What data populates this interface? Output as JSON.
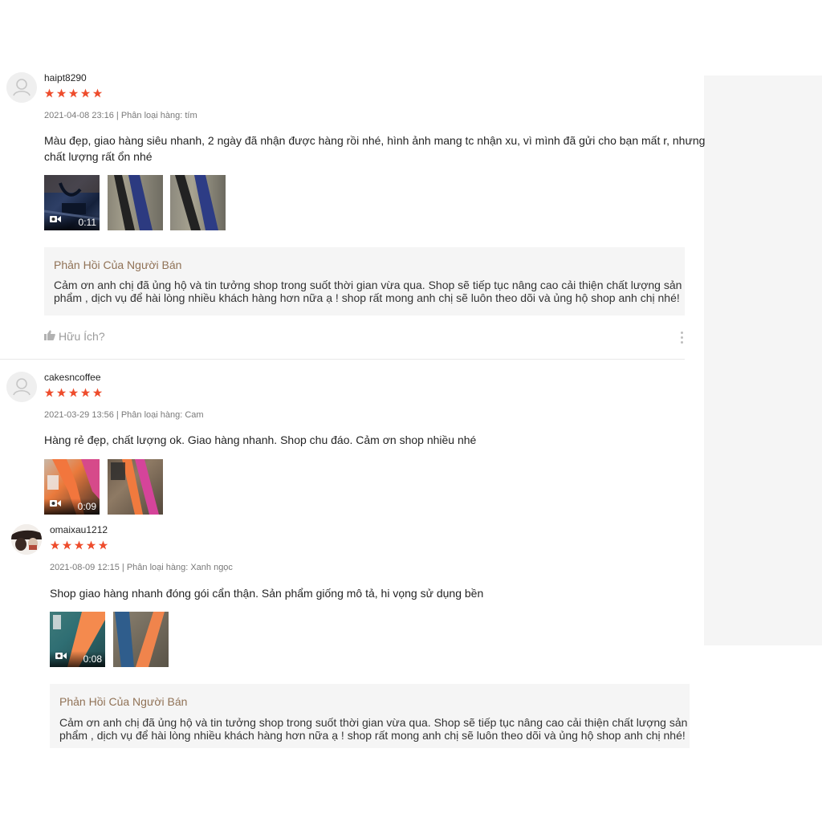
{
  "reviews": [
    {
      "username": "haipt8290",
      "rating": 5,
      "meta": "2021-04-08 23:16 | Phân loại hàng: tím",
      "content_line1": "Màu đẹp, giao hàng siêu nhanh, 2 ngày đã nhận được hàng rồi nhé, hình ảnh mang tc nhận xu, vì mình đã gửi cho bạn mất r, nhưng",
      "content_line2": "chất lượng rất ổn nhé",
      "video_duration": "0:11",
      "reply_title": "Phản Hồi Của Người Bán",
      "reply_line1": "Cảm ơn anh chị đã ủng hộ và tin tưởng shop trong suốt thời gian vừa qua. Shop sẽ tiếp tục nâng cao cải thiện chất lượng sản",
      "reply_line2": "phẩm , dịch vụ để hài lòng nhiều khách hàng hơn nữa ạ ! shop rất mong anh chị sẽ luôn theo dõi và ủng hộ shop anh chị nhé!",
      "helpful_label": "Hữu Ích?"
    },
    {
      "username": "cakesncoffee",
      "rating": 5,
      "meta": "2021-03-29 13:56 | Phân loại hàng: Cam",
      "content_line1": "Hàng rẻ đẹp, chất lượng ok. Giao hàng nhanh. Shop chu đáo. Cảm ơn shop nhiều nhé",
      "video_duration": "0:09"
    },
    {
      "username": "omaixau1212",
      "rating": 5,
      "meta": "2021-08-09 12:15 | Phân loại hàng: Xanh ngọc",
      "content_line1": "Shop giao hàng nhanh đóng gói cẩn thận. Sản phẩm giống mô tả, hi vọng sử dụng bền",
      "video_duration": "0:08",
      "reply_title": "Phản Hồi Của Người Bán",
      "reply_line1": "Cảm ơn anh chị đã ủng hộ và tin tưởng shop trong suốt thời gian vừa qua. Shop sẽ tiếp tục nâng cao cải thiện chất lượng sản",
      "reply_line2": "phẩm , dịch vụ để hài lòng nhiều khách hàng hơn nữa ạ ! shop rất mong anh chị sẽ luôn theo dõi và ủng hộ shop anh chị nhé!"
    }
  ],
  "colors": {
    "star": "#ee4d2d",
    "reply_bg": "#f5f5f5",
    "reply_title": "#8b6b4e"
  }
}
